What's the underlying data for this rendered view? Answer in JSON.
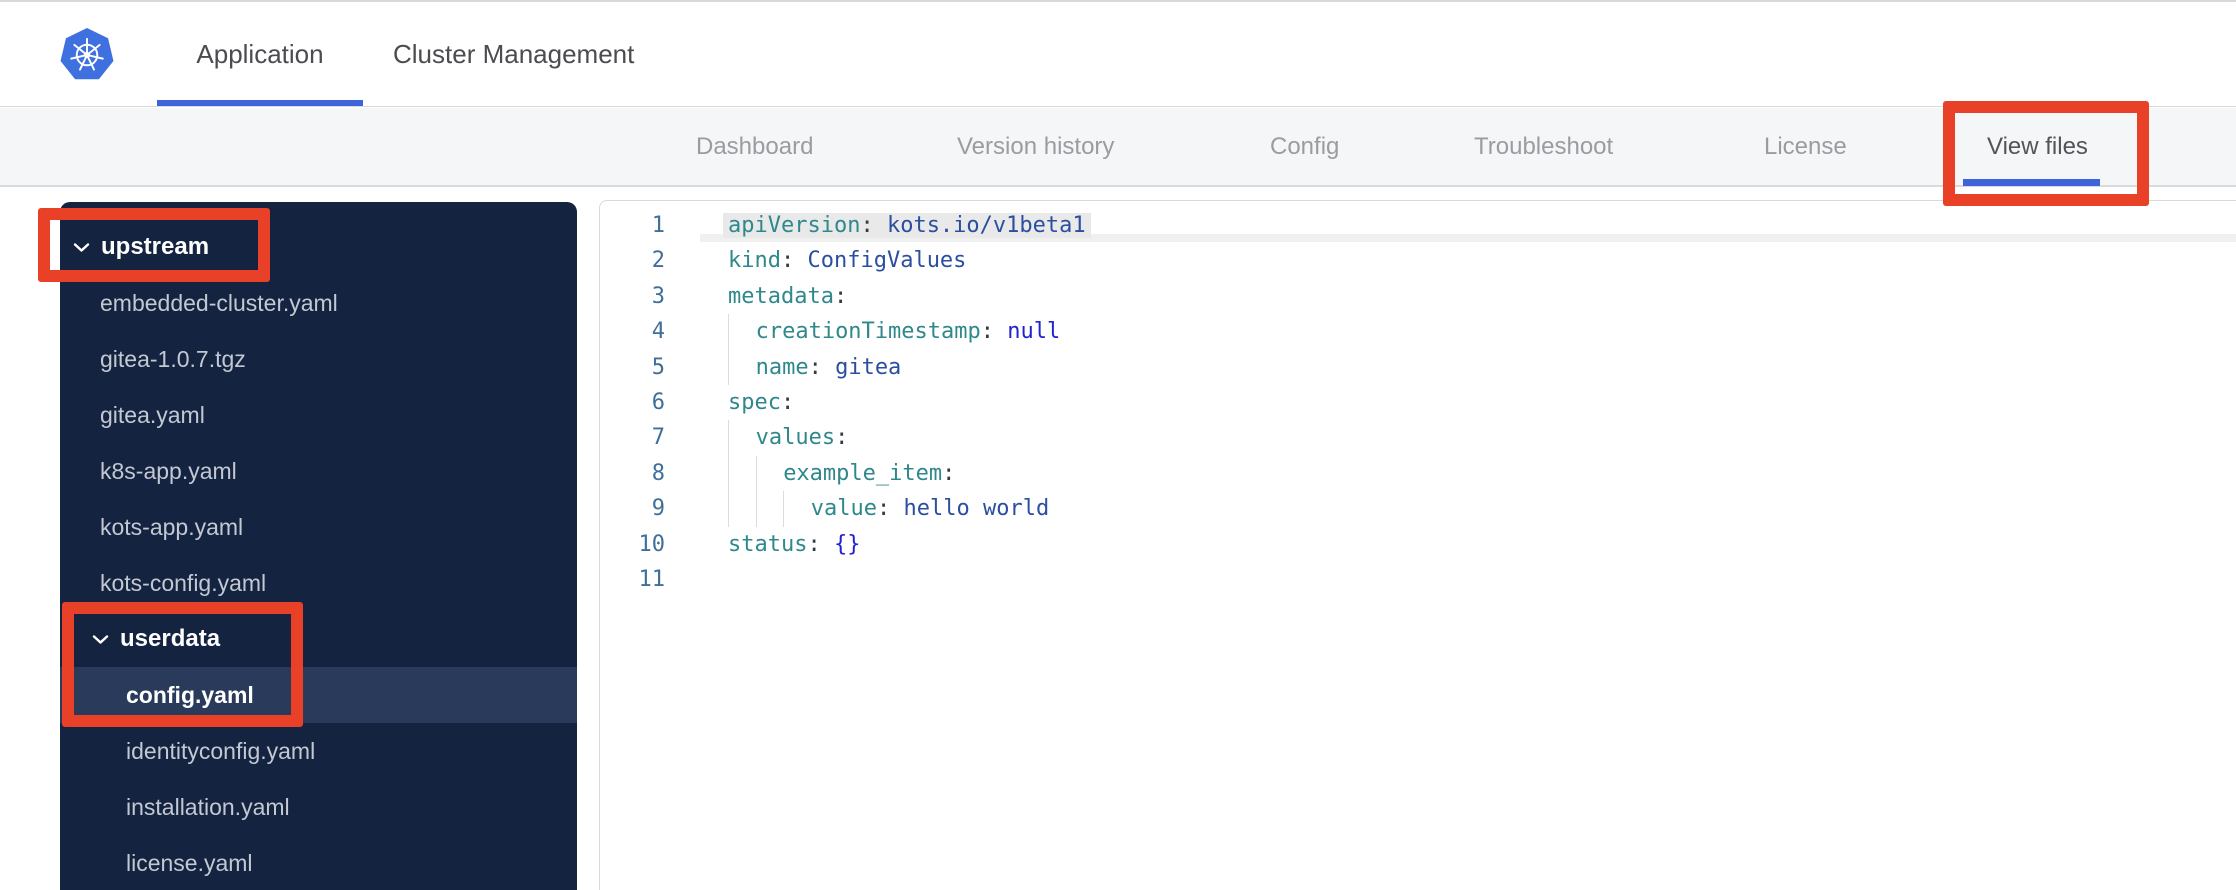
{
  "header": {
    "logo": "kubernetes-logo",
    "tabs": [
      {
        "label": "Application",
        "active": true
      },
      {
        "label": "Cluster Management",
        "active": false
      }
    ]
  },
  "nav": {
    "items": [
      {
        "label": "Dashboard",
        "active": false
      },
      {
        "label": "Version history",
        "active": false
      },
      {
        "label": "Config",
        "active": false
      },
      {
        "label": "Troubleshoot",
        "active": false
      },
      {
        "label": "License",
        "active": false
      },
      {
        "label": "View files",
        "active": true
      }
    ]
  },
  "file_tree": {
    "items": [
      {
        "label": "upstream",
        "type": "folder",
        "level": 0,
        "expanded": true,
        "selected": false
      },
      {
        "label": "embedded-cluster.yaml",
        "type": "file",
        "level": 1,
        "selected": false
      },
      {
        "label": "gitea-1.0.7.tgz",
        "type": "file",
        "level": 1,
        "selected": false
      },
      {
        "label": "gitea.yaml",
        "type": "file",
        "level": 1,
        "selected": false
      },
      {
        "label": "k8s-app.yaml",
        "type": "file",
        "level": 1,
        "selected": false
      },
      {
        "label": "kots-app.yaml",
        "type": "file",
        "level": 1,
        "selected": false
      },
      {
        "label": "kots-config.yaml",
        "type": "file",
        "level": 1,
        "selected": false
      },
      {
        "label": "userdata",
        "type": "folder",
        "level": 1,
        "expanded": true,
        "selected": false
      },
      {
        "label": "config.yaml",
        "type": "file",
        "level": 2,
        "selected": true
      },
      {
        "label": "identityconfig.yaml",
        "type": "file",
        "level": 2,
        "selected": false
      },
      {
        "label": "installation.yaml",
        "type": "file",
        "level": 2,
        "selected": false
      },
      {
        "label": "license.yaml",
        "type": "file",
        "level": 2,
        "selected": false
      }
    ]
  },
  "editor": {
    "language": "yaml",
    "lines": [
      {
        "num": "1",
        "guides": 0,
        "highlighted": true,
        "tokens": [
          {
            "t": "key",
            "v": "apiVersion"
          },
          {
            "t": "punc",
            "v": ": "
          },
          {
            "t": "str",
            "v": "kots.io/v1beta1"
          }
        ]
      },
      {
        "num": "2",
        "guides": 0,
        "highlighted": false,
        "tokens": [
          {
            "t": "key",
            "v": "kind"
          },
          {
            "t": "punc",
            "v": ": "
          },
          {
            "t": "str",
            "v": "ConfigValues"
          }
        ]
      },
      {
        "num": "3",
        "guides": 0,
        "highlighted": false,
        "tokens": [
          {
            "t": "key",
            "v": "metadata"
          },
          {
            "t": "punc",
            "v": ":"
          }
        ]
      },
      {
        "num": "4",
        "guides": 1,
        "highlighted": false,
        "tokens": [
          {
            "t": "key",
            "v": "creationTimestamp"
          },
          {
            "t": "punc",
            "v": ": "
          },
          {
            "t": "kw",
            "v": "null"
          }
        ]
      },
      {
        "num": "5",
        "guides": 1,
        "highlighted": false,
        "tokens": [
          {
            "t": "key",
            "v": "name"
          },
          {
            "t": "punc",
            "v": ": "
          },
          {
            "t": "str",
            "v": "gitea"
          }
        ]
      },
      {
        "num": "6",
        "guides": 0,
        "highlighted": false,
        "tokens": [
          {
            "t": "key",
            "v": "spec"
          },
          {
            "t": "punc",
            "v": ":"
          }
        ]
      },
      {
        "num": "7",
        "guides": 1,
        "highlighted": false,
        "tokens": [
          {
            "t": "key",
            "v": "values"
          },
          {
            "t": "punc",
            "v": ":"
          }
        ]
      },
      {
        "num": "8",
        "guides": 2,
        "highlighted": false,
        "tokens": [
          {
            "t": "key",
            "v": "example_item"
          },
          {
            "t": "punc",
            "v": ":"
          }
        ]
      },
      {
        "num": "9",
        "guides": 3,
        "highlighted": false,
        "tokens": [
          {
            "t": "key",
            "v": "value"
          },
          {
            "t": "punc",
            "v": ": "
          },
          {
            "t": "str",
            "v": "hello world"
          }
        ]
      },
      {
        "num": "10",
        "guides": 0,
        "highlighted": false,
        "tokens": [
          {
            "t": "key",
            "v": "status"
          },
          {
            "t": "punc",
            "v": ": "
          },
          {
            "t": "kw",
            "v": "{}"
          }
        ]
      },
      {
        "num": "11",
        "guides": 0,
        "highlighted": false,
        "tokens": []
      }
    ]
  },
  "annotations": {
    "color": "#e84128",
    "boxes": [
      "upstream-folder",
      "userdata-config-yaml",
      "view-files-tab"
    ]
  },
  "colors": {
    "accent_blue": "#3e63db",
    "logo_blue": "#3f70e0",
    "sidebar_bg": "#14233f",
    "sidebar_selected_bg": "#293a5a",
    "nav_bg": "#f5f6f8",
    "code_key": "#2f888c",
    "code_value": "#2b4ea0",
    "code_keyword": "#2222d2",
    "gutter_number": "#3f6f9b",
    "annotation_red": "#e84128"
  }
}
